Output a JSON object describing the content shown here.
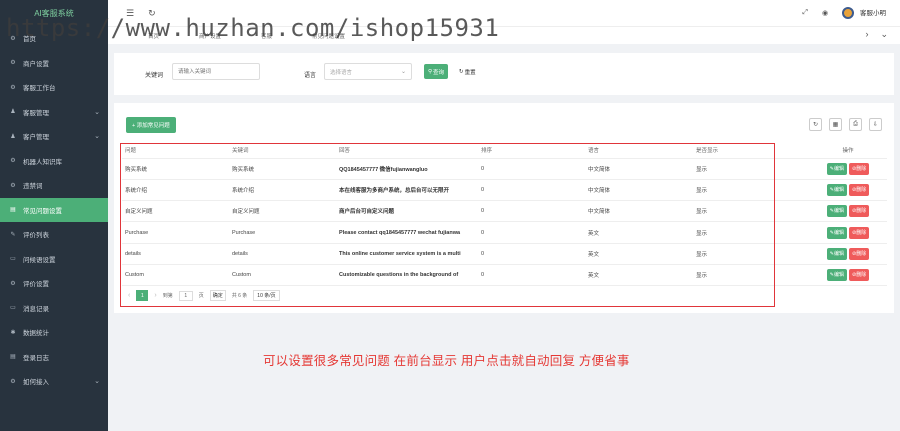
{
  "sidebar": {
    "brand": "AI客服系统",
    "items": [
      {
        "label": "首页",
        "icon": "home-icon",
        "glyph": "⚙",
        "arrow": false,
        "active": false
      },
      {
        "label": "商户设置",
        "icon": "settings-icon",
        "glyph": "⚙",
        "arrow": false,
        "active": false
      },
      {
        "label": "客服工作台",
        "icon": "workbench-icon",
        "glyph": "⚙",
        "arrow": false,
        "active": false
      },
      {
        "label": "客服管理",
        "icon": "user-icon",
        "glyph": "♟",
        "arrow": true,
        "active": false
      },
      {
        "label": "客户管理",
        "icon": "users-icon",
        "glyph": "♟",
        "arrow": true,
        "active": false
      },
      {
        "label": "机器人知识库",
        "icon": "robot-icon",
        "glyph": "⚙",
        "arrow": false,
        "active": false
      },
      {
        "label": "违禁词",
        "icon": "block-icon",
        "glyph": "⚙",
        "arrow": false,
        "active": false
      },
      {
        "label": "常见问题设置",
        "icon": "question-icon",
        "glyph": "▤",
        "arrow": false,
        "active": true
      },
      {
        "label": "评价列表",
        "icon": "list-icon",
        "glyph": "✎",
        "arrow": false,
        "active": false
      },
      {
        "label": "问候语设置",
        "icon": "greeting-icon",
        "glyph": "▭",
        "arrow": false,
        "active": false
      },
      {
        "label": "评价设置",
        "icon": "rating-settings-icon",
        "glyph": "⚙",
        "arrow": false,
        "active": false
      },
      {
        "label": "消息记录",
        "icon": "message-icon",
        "glyph": "▭",
        "arrow": false,
        "active": false
      },
      {
        "label": "数据统计",
        "icon": "chart-icon",
        "glyph": "✱",
        "arrow": false,
        "active": false
      },
      {
        "label": "登录日志",
        "icon": "log-icon",
        "glyph": "▤",
        "arrow": false,
        "active": false
      },
      {
        "label": "如何接入",
        "icon": "access-icon",
        "glyph": "⚙",
        "arrow": true,
        "active": false
      }
    ]
  },
  "topbar": {
    "menu_icon": "☰",
    "refresh_icon": "↻",
    "fullscreen_icon": "⤢",
    "globe_icon": "◉",
    "user_name": "客服小明"
  },
  "tabs": [
    "首页",
    "商户设置",
    "客服",
    "常见问题设置"
  ],
  "watermark": "https://www.huzhan.com/ishop15931",
  "search": {
    "keyword_label": "关键词",
    "keyword_placeholder": "请输入关键词",
    "language_label": "语言",
    "language_placeholder": "选择语言",
    "search_button": "查询",
    "reset_button": "重置"
  },
  "toolbar": {
    "add_button": "+ 添加常见问题",
    "tools": [
      {
        "name": "refresh-tool-icon",
        "glyph": "↻"
      },
      {
        "name": "columns-tool-icon",
        "glyph": "▦"
      },
      {
        "name": "print-tool-icon",
        "glyph": "⎙"
      },
      {
        "name": "export-tool-icon",
        "glyph": "⇩"
      }
    ]
  },
  "table": {
    "columns": [
      "问题",
      "关键词",
      "回答",
      "排序",
      "语言",
      "是否显示",
      "操作"
    ],
    "rows": [
      {
        "question": "购买系统",
        "keyword": "购买系统",
        "answer": "QQ1845457777 微信fujianwangluo",
        "sort": "0",
        "language": "中文简体",
        "visible": "显示"
      },
      {
        "question": "系统介绍",
        "keyword": "系统介绍",
        "answer": "本在线客服为多商户系统，总后台可以无限开",
        "sort": "0",
        "language": "中文简体",
        "visible": "显示"
      },
      {
        "question": "自定义问题",
        "keyword": "自定义问题",
        "answer": "商户后台可自定义问题",
        "sort": "0",
        "language": "中文简体",
        "visible": "显示"
      },
      {
        "question": "Purchase",
        "keyword": "Purchase",
        "answer": "Please contact qq1845457777 wechat fujianwa",
        "sort": "0",
        "language": "英文",
        "visible": "显示"
      },
      {
        "question": "details",
        "keyword": "details",
        "answer": "This online customer service system is a multi",
        "sort": "0",
        "language": "英文",
        "visible": "显示"
      },
      {
        "question": "Custom",
        "keyword": "Custom",
        "answer": "Customizable questions in the background of",
        "sort": "0",
        "language": "英文",
        "visible": "显示"
      }
    ],
    "edit_label": "✎编辑",
    "delete_label": "⊘删除"
  },
  "pager": {
    "current": "1",
    "goto_label": "到第",
    "goto_value": "1",
    "page_unit": "页",
    "confirm": "确定",
    "total": "共 6 条",
    "page_size": "10 条/页"
  },
  "caption": "可以设置很多常见问题 在前台显示 用户点击就自动回复 方便省事",
  "colors": {
    "accent": "#4caf78",
    "danger": "#ef5b5b",
    "sidebar": "#28333e",
    "frame": "#e0353a"
  }
}
